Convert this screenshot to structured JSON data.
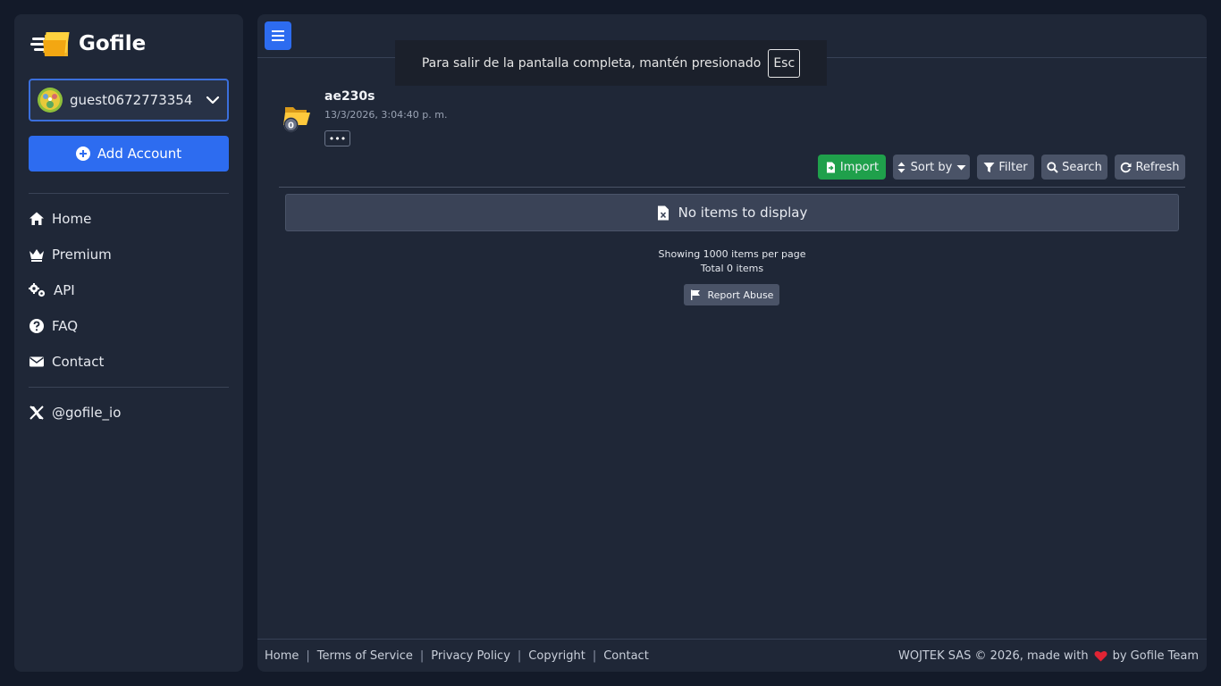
{
  "brand": {
    "name": "Gofile"
  },
  "account": {
    "username": "guest0672773354"
  },
  "sidebar": {
    "add_account_label": "Add Account",
    "items": [
      {
        "label": "Home",
        "icon": "home-icon"
      },
      {
        "label": "Premium",
        "icon": "crown-icon"
      },
      {
        "label": "API",
        "icon": "gears-icon"
      },
      {
        "label": "FAQ",
        "icon": "question-circle-icon"
      },
      {
        "label": "Contact",
        "icon": "envelope-icon"
      }
    ],
    "social": {
      "label": "@gofile_io",
      "icon": "x-logo-icon"
    }
  },
  "fullscreen_toast": {
    "message": "Para salir de la pantalla completa, mantén presionado",
    "key": "Esc"
  },
  "folder": {
    "name": "ae230s",
    "date": "13/3/2026, 3:04:40 p. m.",
    "badge_count": "0",
    "more_label": "•••"
  },
  "toolbar": {
    "import": "Import",
    "sort": "Sort by",
    "filter": "Filter",
    "search": "Search",
    "refresh": "Refresh"
  },
  "content": {
    "empty_message": "No items to display",
    "showing_prefix": "Showing ",
    "per_page": "1000",
    "showing_suffix": " items per page",
    "total_prefix": "Total ",
    "total": "0",
    "total_suffix": " items",
    "report_label": "Report Abuse"
  },
  "footer": {
    "links": [
      "Home",
      "Terms of Service",
      "Privacy Policy",
      "Copyright",
      "Contact"
    ],
    "copyright_prefix": "WOJTEK SAS © 2026, made with",
    "copyright_suffix": "by Gofile Team"
  },
  "colors": {
    "accent": "#2d6cf0",
    "import_green": "#1fa04b",
    "background": "#131a29",
    "panel": "#1f2737"
  }
}
